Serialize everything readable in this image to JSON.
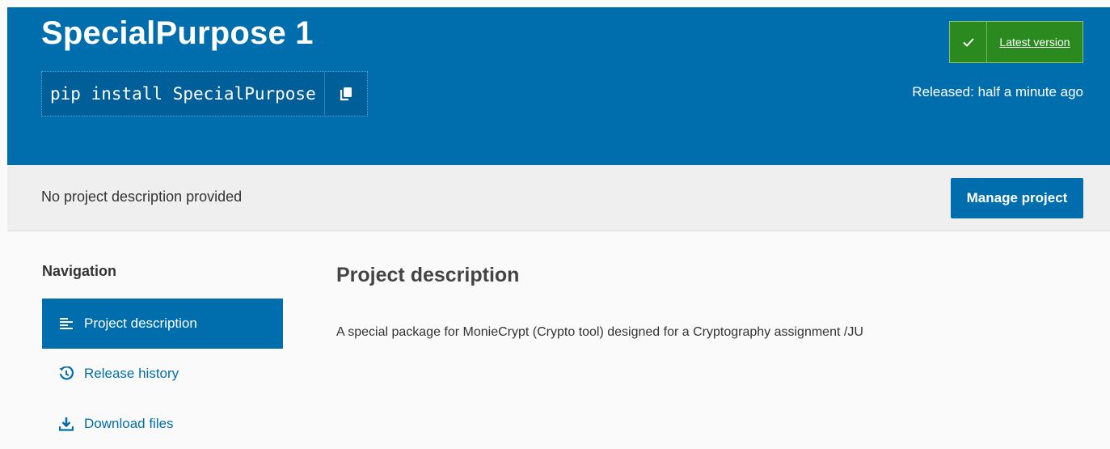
{
  "header": {
    "title": "SpecialPurpose 1",
    "pip_command": "pip install SpecialPurpose",
    "latest_label": "Latest version",
    "released": "Released: half a minute ago"
  },
  "summary": {
    "text": "No project description provided",
    "manage_button": "Manage project"
  },
  "navigation": {
    "heading": "Navigation",
    "items": [
      {
        "label": "Project description",
        "icon": "align-left-icon",
        "active": true
      },
      {
        "label": "Release history",
        "icon": "history-icon",
        "active": false
      },
      {
        "label": "Download files",
        "icon": "download-icon",
        "active": false
      }
    ]
  },
  "main": {
    "heading": "Project description",
    "body": "A special package for MonieCrypt (Crypto tool) designed for a Cryptography assignment /JU"
  },
  "colors": {
    "brand_blue": "#006dad",
    "latest_green": "#2b8a1f"
  }
}
